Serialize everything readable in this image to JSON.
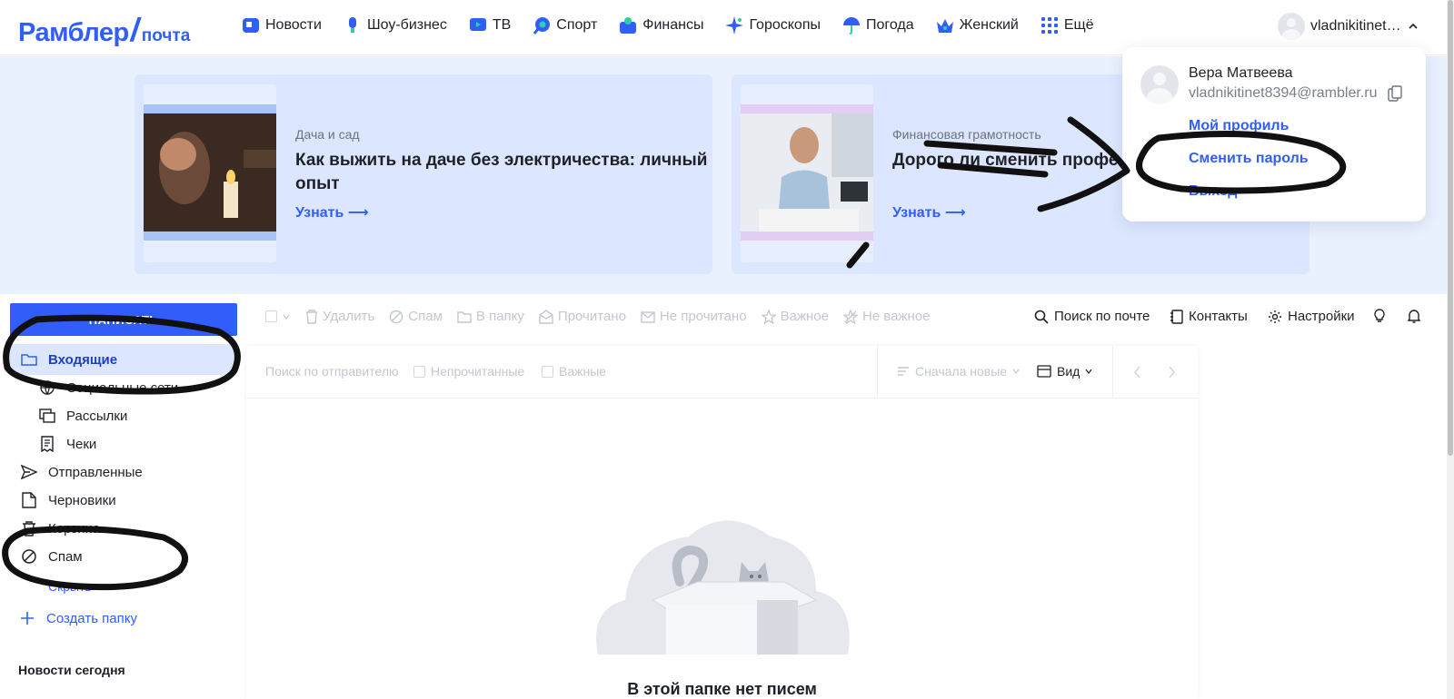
{
  "header": {
    "logo_main": "Рамблер",
    "logo_slash": "/",
    "logo_sub": "почта",
    "nav": [
      {
        "label": "Новости",
        "icon": "news-icon"
      },
      {
        "label": "Шоу-бизнес",
        "icon": "microphone-icon"
      },
      {
        "label": "ТВ",
        "icon": "tv-icon"
      },
      {
        "label": "Спорт",
        "icon": "sport-icon"
      },
      {
        "label": "Финансы",
        "icon": "finance-icon"
      },
      {
        "label": "Гороскопы",
        "icon": "star-icon"
      },
      {
        "label": "Погода",
        "icon": "umbrella-icon"
      },
      {
        "label": "Женский",
        "icon": "crown-icon"
      },
      {
        "label": "Ещё",
        "icon": "grid-icon"
      }
    ],
    "user_short": "vladnikitinet…"
  },
  "promo": [
    {
      "category": "Дача и сад",
      "title": "Как выжить на даче без электричества: личный опыт",
      "more": "Узнать ⟶"
    },
    {
      "category": "Финансовая грамотность",
      "title": "Дорого ли сменить профессию: окупаемость образования",
      "more": "Узнать ⟶"
    }
  ],
  "account_menu": {
    "name": "Вера Матвеева",
    "email": "vladnikitinet8394@rambler.ru",
    "links": [
      "Мой профиль",
      "Сменить пароль",
      "Выход"
    ]
  },
  "sidebar": {
    "compose": "НАПИСАТЬ",
    "folders": [
      {
        "label": "Входящие",
        "icon": "folder-icon"
      },
      {
        "label": "Социальные сети",
        "icon": "globe-icon"
      },
      {
        "label": "Рассылки",
        "icon": "newsletters-icon"
      },
      {
        "label": "Чеки",
        "icon": "receipt-icon"
      },
      {
        "label": "Отправленные",
        "icon": "send-icon"
      },
      {
        "label": "Черновики",
        "icon": "draft-icon"
      },
      {
        "label": "Корзина",
        "icon": "trash-icon"
      },
      {
        "label": "Спам",
        "icon": "spam-icon"
      },
      {
        "label": "Скрыть",
        "icon": "chevron-up-icon"
      }
    ],
    "create_folder": "Создать папку",
    "news_today": "Новости сегодня"
  },
  "toolbar": {
    "actions": [
      "Удалить",
      "Спам",
      "В папку",
      "Прочитано",
      "Не прочитано",
      "Важное",
      "Не важное"
    ],
    "right": [
      "Поиск по почте",
      "Контакты",
      "Настройки"
    ]
  },
  "mail_list": {
    "sender_search_placeholder": "Поиск по отправителю",
    "filter_unread": "Непрочитанные",
    "filter_important": "Важные",
    "sort": "Сначала новые",
    "view": "Вид",
    "empty_title": "В этой папке нет писем"
  },
  "colors": {
    "accent": "#315efb",
    "active_bg": "#dce7ff",
    "promo_bg": "#e9f1ff",
    "annotation_ink": "#111111"
  }
}
